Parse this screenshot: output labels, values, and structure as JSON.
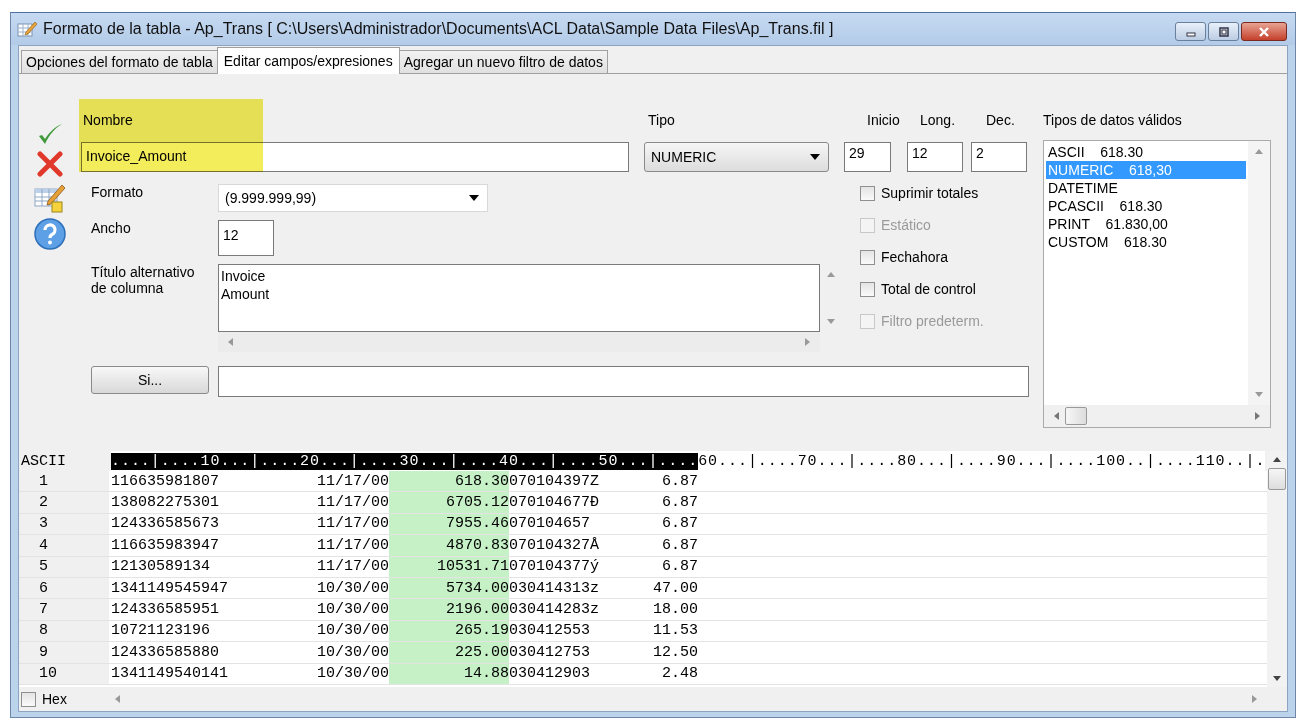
{
  "window": {
    "title": "Formato de la tabla - Ap_Trans [ C:\\Users\\Administrador\\Documents\\ACL Data\\Sample Data Files\\Ap_Trans.fil ]"
  },
  "tabs": [
    {
      "label": "Opciones del formato de tabla",
      "selected": false
    },
    {
      "label": "Editar campos/expresiones",
      "selected": true
    },
    {
      "label": "Agregar un nuevo filtro de datos",
      "selected": false
    }
  ],
  "form": {
    "name_label": "Nombre",
    "name_value": "Invoice_Amount",
    "type_label": "Tipo",
    "type_value": "NUMERIC",
    "start_label": "Inicio",
    "start_value": "29",
    "length_label": "Long.",
    "length_value": "12",
    "decimals_label": "Dec.",
    "decimals_value": "2",
    "format_label": "Formato",
    "format_value": "(9.999.999,99)",
    "width_label": "Ancho",
    "width_value": "12",
    "alt_title_label": "Título alternativo de columna",
    "alt_title_value": "Invoice\nAmount",
    "if_button": "Si..."
  },
  "options": [
    {
      "label": "Suprimir totales",
      "checked": false,
      "disabled": false
    },
    {
      "label": "Estático",
      "checked": false,
      "disabled": true
    },
    {
      "label": "Fechahora",
      "checked": false,
      "disabled": false
    },
    {
      "label": "Total de control",
      "checked": false,
      "disabled": false
    },
    {
      "label": "Filtro predeterm.",
      "checked": false,
      "disabled": true
    }
  ],
  "valid_types": {
    "title": "Tipos de datos válidos",
    "items": [
      {
        "name": "ASCII",
        "value": "618.30",
        "selected": false
      },
      {
        "name": "NUMERIC",
        "value": "618,30",
        "selected": true
      },
      {
        "name": "DATETIME",
        "value": "",
        "selected": false
      },
      {
        "name": "PCASCII",
        "value": "618.30",
        "selected": false
      },
      {
        "name": "PRINT",
        "value": "61.830,00",
        "selected": false
      },
      {
        "name": "CUSTOM",
        "value": "618.30",
        "selected": false
      }
    ]
  },
  "preview": {
    "mode_label": "ASCII",
    "ruler_selected": "....|....10...|....20...|....30...|....40...|....50...|....",
    "ruler_rest": "60...|....70...|....80...|....90...|....100..|....110..|.",
    "rows": [
      {
        "number": "1",
        "id": "116635981807",
        "date": "11/17/00",
        "amount": "618.30",
        "code": "070104397Z",
        "value": "6.87"
      },
      {
        "number": "2",
        "id": "138082275301",
        "date": "11/17/00",
        "amount": "6705.12",
        "code": "070104677Ð",
        "value": "6.87"
      },
      {
        "number": "3",
        "id": "124336585673",
        "date": "11/17/00",
        "amount": "7955.46",
        "code": "070104657",
        "value": "6.87"
      },
      {
        "number": "4",
        "id": "116635983947",
        "date": "11/17/00",
        "amount": "4870.83",
        "code": "070104327Å",
        "value": "6.87"
      },
      {
        "number": "5",
        "id": "12130589134",
        "date": "11/17/00",
        "amount": "10531.71",
        "code": "070104377ý",
        "value": "6.87"
      },
      {
        "number": "6",
        "id": "1341149545947",
        "date": "10/30/00",
        "amount": "5734.00",
        "code": "030414313z",
        "value": "47.00"
      },
      {
        "number": "7",
        "id": "124336585951",
        "date": "10/30/00",
        "amount": "2196.00",
        "code": "030414283z",
        "value": "18.00"
      },
      {
        "number": "8",
        "id": "10721123196",
        "date": "10/30/00",
        "amount": "265.19",
        "code": "030412553",
        "value": "11.53"
      },
      {
        "number": "9",
        "id": "124336585880",
        "date": "10/30/00",
        "amount": "225.00",
        "code": "030412753",
        "value": "12.50"
      },
      {
        "number": "10",
        "id": "1341149540141",
        "date": "10/30/00",
        "amount": "14.88",
        "code": "030412903",
        "value": "2.48"
      }
    ]
  },
  "hex": {
    "label": "Hex",
    "checked": false
  }
}
